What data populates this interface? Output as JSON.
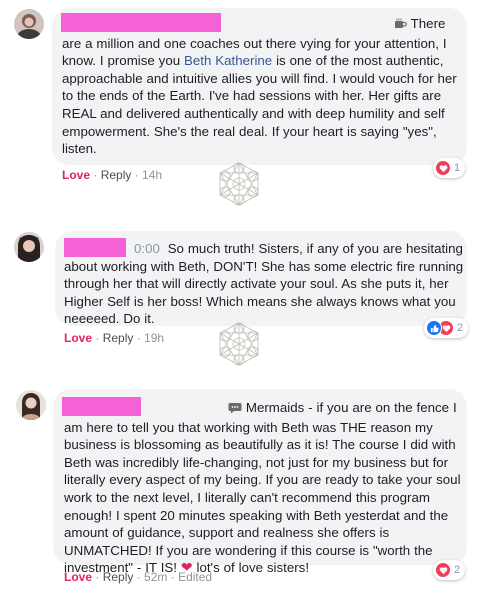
{
  "comments": [
    {
      "text_lead": "There are a million and one coaches out there vying for your attention, I know. I promise you ",
      "mention": "Beth Katherine",
      "text_rest": " is one of the most authentic, approachable and intuitive allies you will find. I would vouch for her to the ends of the Earth. I've had sessions with her. Her gifts are REAL and delivered authentically and with deep humility and self empowerment. She's the real deal. If your heart is saying \"yes\", listen.",
      "lead_icon": "coffee-icon",
      "actions": {
        "love": "Love",
        "sep1": " · ",
        "reply": "Reply",
        "sep2": " · ",
        "time": "14h"
      },
      "reactions": {
        "types": [
          "love"
        ],
        "count": "1"
      }
    },
    {
      "prefix": "0:00",
      "text": "So much truth! Sisters, if any of you are hesitating about working with Beth, DON'T! She has some electric fire running through her that will directly activate your soul. As she puts it, her Higher Self is her boss! Which means she always knows what you neeeeed. Do it.",
      "actions": {
        "love": "Love",
        "sep1": " · ",
        "reply": "Reply",
        "sep2": " · ",
        "time": "19h"
      },
      "reactions": {
        "types": [
          "like",
          "love"
        ],
        "count": "2"
      }
    },
    {
      "lead_icon": "speech-bubble-icon",
      "text_lead": "Mermaids - if you are on the fence I am here to tell you that working with Beth was THE reason my business is blossoming as beautifully as it is! The course I did with Beth was incredibly life-changing, not just for my business but for literally every aspect of my being. If you are ready to take your soul work to the next level, I literally can't recommend this program enough! I spent 20 minutes speaking with Beth yesterdat and the amount of guidance, support and realness she offers is UNMATCHED! If you are wondering if this course is \"worth the investment\" - IT IS!",
      "text_tail": " lot's of love sisters!",
      "actions": {
        "love": "Love",
        "sep1": " · ",
        "reply": "Reply",
        "sep2": " · ",
        "time": "52m",
        "sep3": " · ",
        "edited": "Edited"
      },
      "reactions": {
        "types": [
          "love"
        ],
        "count": "2"
      }
    }
  ],
  "colors": {
    "redaction": "#f562d6",
    "bubble": "#f2f3f5",
    "love": "#e0245e",
    "link": "#385898"
  }
}
